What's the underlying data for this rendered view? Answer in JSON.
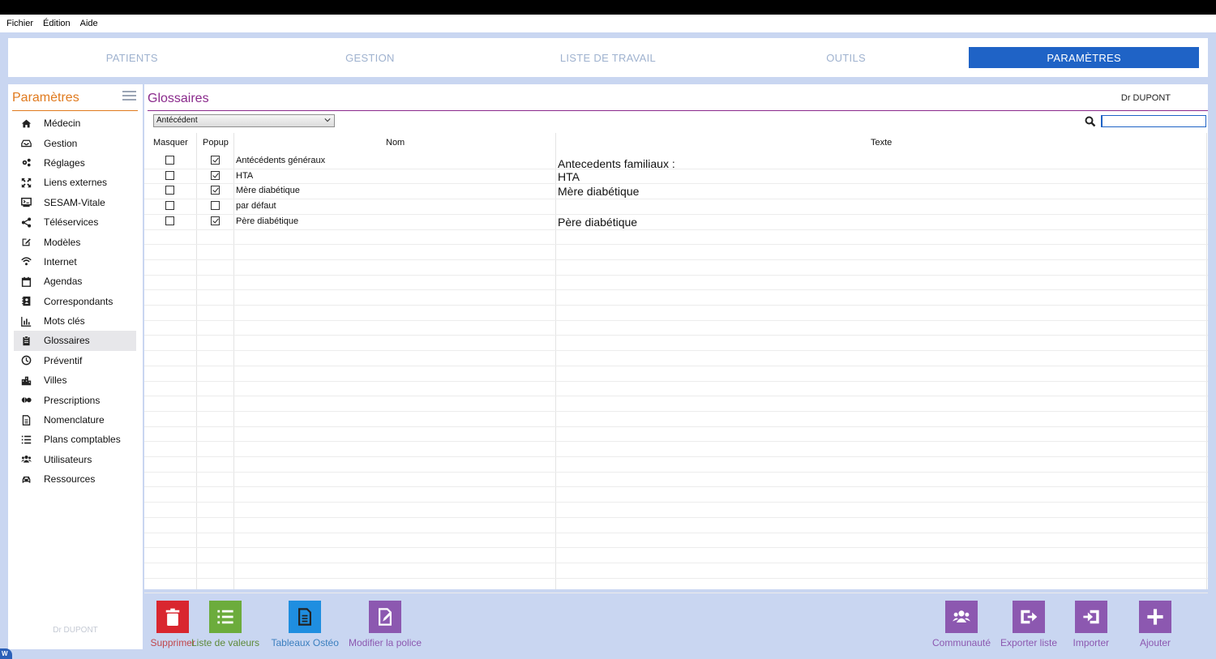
{
  "menubar": {
    "items": [
      "Fichier",
      "Édition",
      "Aide"
    ]
  },
  "nav": {
    "tabs": [
      {
        "label": "PATIENTS",
        "active": false
      },
      {
        "label": "GESTION",
        "active": false
      },
      {
        "label": "LISTE DE TRAVAIL",
        "active": false
      },
      {
        "label": "OUTILS",
        "active": false
      },
      {
        "label": "PARAMÈTRES",
        "active": true
      }
    ]
  },
  "sidebar": {
    "title": "Paramètres",
    "items": [
      {
        "label": "Médecin",
        "icon": "home-icon",
        "active": false
      },
      {
        "label": "Gestion",
        "icon": "inbox-icon",
        "active": false
      },
      {
        "label": "Réglages",
        "icon": "gears-icon",
        "active": false
      },
      {
        "label": "Liens externes",
        "icon": "expand-arrows-icon",
        "active": false
      },
      {
        "label": "SESAM-Vitale",
        "icon": "card-terminal-icon",
        "active": false
      },
      {
        "label": "Téléservices",
        "icon": "share-icon",
        "active": false
      },
      {
        "label": "Modèles",
        "icon": "edit-icon",
        "active": false
      },
      {
        "label": "Internet",
        "icon": "wifi-icon",
        "active": false
      },
      {
        "label": "Agendas",
        "icon": "calendar-icon",
        "active": false
      },
      {
        "label": "Correspondants",
        "icon": "contact-book-icon",
        "active": false
      },
      {
        "label": "Mots clés",
        "icon": "bar-chart-icon",
        "active": false
      },
      {
        "label": "Glossaires",
        "icon": "clipboard-icon",
        "active": true
      },
      {
        "label": "Préventif",
        "icon": "clock-icon",
        "active": false
      },
      {
        "label": "Villes",
        "icon": "buildings-icon",
        "active": false
      },
      {
        "label": "Prescriptions",
        "icon": "pills-icon",
        "active": false
      },
      {
        "label": "Nomenclature",
        "icon": "document-icon",
        "active": false
      },
      {
        "label": "Plans comptables",
        "icon": "list-icon",
        "active": false
      },
      {
        "label": "Utilisateurs",
        "icon": "users-icon",
        "active": false
      },
      {
        "label": "Ressources",
        "icon": "car-icon",
        "active": false
      }
    ],
    "footer": "Dr DUPONT"
  },
  "main": {
    "title": "Glossaires",
    "doctor": "Dr DUPONT",
    "dropdown_value": "Antécédent",
    "columns": {
      "masquer": "Masquer",
      "popup": "Popup",
      "nom": "Nom",
      "texte": "Texte"
    },
    "rows": [
      {
        "masquer": false,
        "popup": true,
        "nom": "Antécédents généraux",
        "texte": "Antecedents familiaux :"
      },
      {
        "masquer": false,
        "popup": true,
        "nom": "HTA",
        "texte": "HTA"
      },
      {
        "masquer": false,
        "popup": true,
        "nom": "Mère diabétique",
        "texte": "Mère diabétique"
      },
      {
        "masquer": false,
        "popup": false,
        "nom": "par défaut",
        "texte": ""
      },
      {
        "masquer": false,
        "popup": true,
        "nom": "Père diabétique",
        "texte": "Père diabétique"
      }
    ]
  },
  "toolbar": {
    "left": [
      {
        "label": "Supprimer",
        "color": "#d9262f",
        "text_color": "#c0484d",
        "icon": "trash-icon"
      },
      {
        "label": "Liste de valeurs",
        "color": "#6cac3c",
        "text_color": "#5e8a3a",
        "icon": "list-icon"
      },
      {
        "label": "Tableaux Ostéo",
        "color": "#1f8ee0",
        "text_color": "#3b7fbf",
        "icon": "document-icon"
      },
      {
        "label": "Modifier la police",
        "color": "#8c58b0",
        "text_color": "#8c58b0",
        "icon": "edit-document-icon"
      }
    ],
    "right": [
      {
        "label": "Communauté",
        "color": "#8c58b0",
        "text_color": "#8c58b0",
        "icon": "users-icon"
      },
      {
        "label": "Exporter liste",
        "color": "#8c58b0",
        "text_color": "#8c58b0",
        "icon": "export-icon"
      },
      {
        "label": "Importer",
        "color": "#8c58b0",
        "text_color": "#8c58b0",
        "icon": "import-icon"
      },
      {
        "label": "Ajouter",
        "color": "#8c58b0",
        "text_color": "#8c58b0",
        "icon": "plus-icon"
      }
    ]
  }
}
